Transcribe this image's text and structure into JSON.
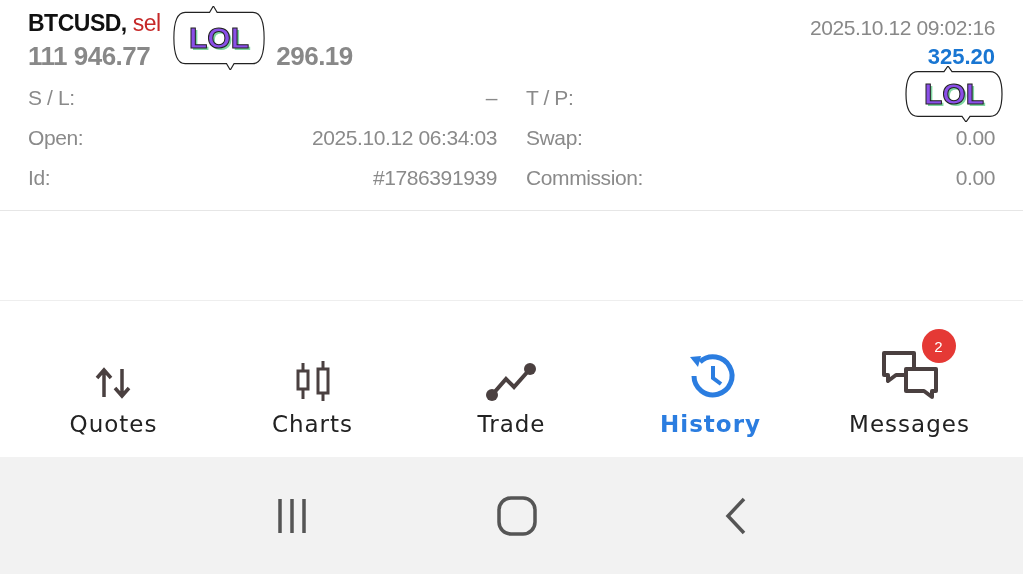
{
  "position": {
    "symbol": "BTCUSD,",
    "side": "sel",
    "open_price": "111 946.77",
    "close_price": "296.19",
    "time": "2025.10.12 09:02:16",
    "profit": "325.20"
  },
  "stickers": [
    {
      "text": "LOL"
    },
    {
      "text": "LOL"
    }
  ],
  "details": [
    {
      "label": "S / L:",
      "value": "–"
    },
    {
      "label": "T / P:"
    },
    {
      "label": "Open:",
      "value": "2025.10.12 06:34:03"
    },
    {
      "label": "Swap:",
      "value": "0.00"
    },
    {
      "label": "Id:",
      "value": "#1786391939"
    },
    {
      "label": "Commission:",
      "value": "0.00"
    }
  ],
  "nav": [
    {
      "label": "Quotes",
      "selected": false
    },
    {
      "label": "Charts",
      "selected": false
    },
    {
      "label": "Trade",
      "selected": false
    },
    {
      "label": "History",
      "selected": true
    },
    {
      "label": "Messages",
      "selected": false,
      "badge": "2"
    }
  ]
}
